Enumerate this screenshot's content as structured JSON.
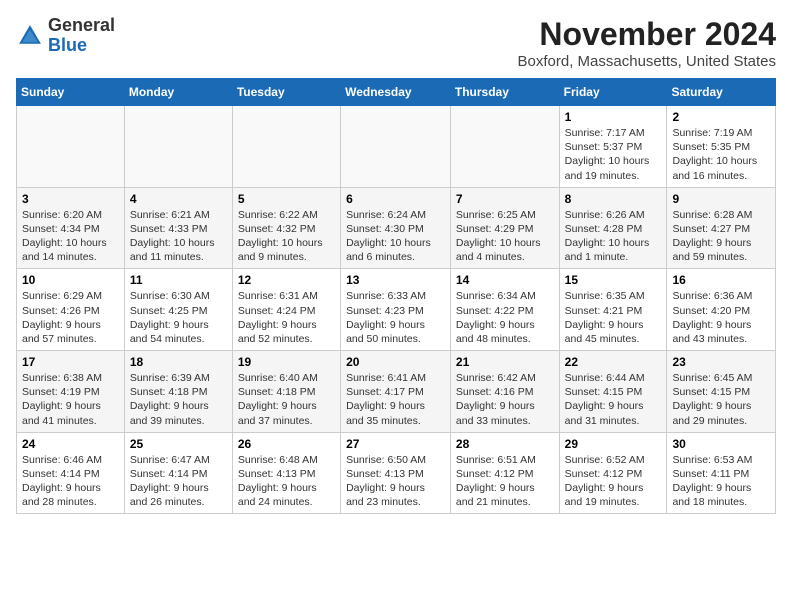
{
  "header": {
    "logo_general": "General",
    "logo_blue": "Blue",
    "month_year": "November 2024",
    "location": "Boxford, Massachusetts, United States"
  },
  "weekdays": [
    "Sunday",
    "Monday",
    "Tuesday",
    "Wednesday",
    "Thursday",
    "Friday",
    "Saturday"
  ],
  "weeks": [
    [
      {
        "day": "",
        "info": ""
      },
      {
        "day": "",
        "info": ""
      },
      {
        "day": "",
        "info": ""
      },
      {
        "day": "",
        "info": ""
      },
      {
        "day": "",
        "info": ""
      },
      {
        "day": "1",
        "info": "Sunrise: 7:17 AM\nSunset: 5:37 PM\nDaylight: 10 hours and 19 minutes."
      },
      {
        "day": "2",
        "info": "Sunrise: 7:19 AM\nSunset: 5:35 PM\nDaylight: 10 hours and 16 minutes."
      }
    ],
    [
      {
        "day": "3",
        "info": "Sunrise: 6:20 AM\nSunset: 4:34 PM\nDaylight: 10 hours and 14 minutes."
      },
      {
        "day": "4",
        "info": "Sunrise: 6:21 AM\nSunset: 4:33 PM\nDaylight: 10 hours and 11 minutes."
      },
      {
        "day": "5",
        "info": "Sunrise: 6:22 AM\nSunset: 4:32 PM\nDaylight: 10 hours and 9 minutes."
      },
      {
        "day": "6",
        "info": "Sunrise: 6:24 AM\nSunset: 4:30 PM\nDaylight: 10 hours and 6 minutes."
      },
      {
        "day": "7",
        "info": "Sunrise: 6:25 AM\nSunset: 4:29 PM\nDaylight: 10 hours and 4 minutes."
      },
      {
        "day": "8",
        "info": "Sunrise: 6:26 AM\nSunset: 4:28 PM\nDaylight: 10 hours and 1 minute."
      },
      {
        "day": "9",
        "info": "Sunrise: 6:28 AM\nSunset: 4:27 PM\nDaylight: 9 hours and 59 minutes."
      }
    ],
    [
      {
        "day": "10",
        "info": "Sunrise: 6:29 AM\nSunset: 4:26 PM\nDaylight: 9 hours and 57 minutes."
      },
      {
        "day": "11",
        "info": "Sunrise: 6:30 AM\nSunset: 4:25 PM\nDaylight: 9 hours and 54 minutes."
      },
      {
        "day": "12",
        "info": "Sunrise: 6:31 AM\nSunset: 4:24 PM\nDaylight: 9 hours and 52 minutes."
      },
      {
        "day": "13",
        "info": "Sunrise: 6:33 AM\nSunset: 4:23 PM\nDaylight: 9 hours and 50 minutes."
      },
      {
        "day": "14",
        "info": "Sunrise: 6:34 AM\nSunset: 4:22 PM\nDaylight: 9 hours and 48 minutes."
      },
      {
        "day": "15",
        "info": "Sunrise: 6:35 AM\nSunset: 4:21 PM\nDaylight: 9 hours and 45 minutes."
      },
      {
        "day": "16",
        "info": "Sunrise: 6:36 AM\nSunset: 4:20 PM\nDaylight: 9 hours and 43 minutes."
      }
    ],
    [
      {
        "day": "17",
        "info": "Sunrise: 6:38 AM\nSunset: 4:19 PM\nDaylight: 9 hours and 41 minutes."
      },
      {
        "day": "18",
        "info": "Sunrise: 6:39 AM\nSunset: 4:18 PM\nDaylight: 9 hours and 39 minutes."
      },
      {
        "day": "19",
        "info": "Sunrise: 6:40 AM\nSunset: 4:18 PM\nDaylight: 9 hours and 37 minutes."
      },
      {
        "day": "20",
        "info": "Sunrise: 6:41 AM\nSunset: 4:17 PM\nDaylight: 9 hours and 35 minutes."
      },
      {
        "day": "21",
        "info": "Sunrise: 6:42 AM\nSunset: 4:16 PM\nDaylight: 9 hours and 33 minutes."
      },
      {
        "day": "22",
        "info": "Sunrise: 6:44 AM\nSunset: 4:15 PM\nDaylight: 9 hours and 31 minutes."
      },
      {
        "day": "23",
        "info": "Sunrise: 6:45 AM\nSunset: 4:15 PM\nDaylight: 9 hours and 29 minutes."
      }
    ],
    [
      {
        "day": "24",
        "info": "Sunrise: 6:46 AM\nSunset: 4:14 PM\nDaylight: 9 hours and 28 minutes."
      },
      {
        "day": "25",
        "info": "Sunrise: 6:47 AM\nSunset: 4:14 PM\nDaylight: 9 hours and 26 minutes."
      },
      {
        "day": "26",
        "info": "Sunrise: 6:48 AM\nSunset: 4:13 PM\nDaylight: 9 hours and 24 minutes."
      },
      {
        "day": "27",
        "info": "Sunrise: 6:50 AM\nSunset: 4:13 PM\nDaylight: 9 hours and 23 minutes."
      },
      {
        "day": "28",
        "info": "Sunrise: 6:51 AM\nSunset: 4:12 PM\nDaylight: 9 hours and 21 minutes."
      },
      {
        "day": "29",
        "info": "Sunrise: 6:52 AM\nSunset: 4:12 PM\nDaylight: 9 hours and 19 minutes."
      },
      {
        "day": "30",
        "info": "Sunrise: 6:53 AM\nSunset: 4:11 PM\nDaylight: 9 hours and 18 minutes."
      }
    ]
  ]
}
